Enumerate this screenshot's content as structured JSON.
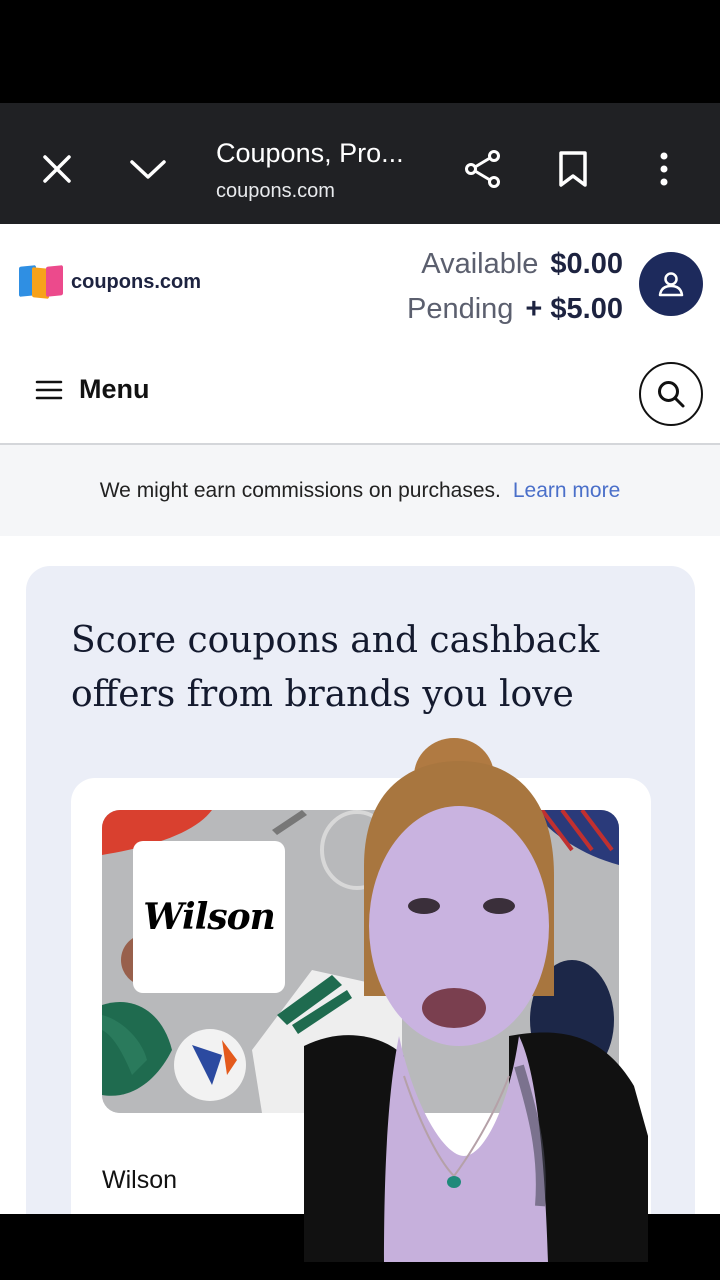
{
  "browser": {
    "tab_title": "Coupons, Pro...",
    "url": "coupons.com"
  },
  "header": {
    "logo_text": "coupons.com",
    "available_label": "Available",
    "available_value": "$0.00",
    "pending_label": "Pending",
    "pending_value": "+ $5.00",
    "menu_label": "Menu"
  },
  "disclaimer": {
    "text": "We might earn commissions on purchases.",
    "link": "Learn more"
  },
  "hero": {
    "title": "Score coupons and cashback offers from brands you love"
  },
  "brand_card": {
    "logo_text": "Wilson",
    "name": "Wilson"
  },
  "colors": {
    "accent_navy": "#1d2a5c",
    "link_blue": "#4a6fc9",
    "hero_bg": "#ebeef7"
  },
  "icons": [
    "close-icon",
    "chevron-down-icon",
    "share-icon",
    "bookmark-icon",
    "more-vert-icon",
    "user-icon",
    "hamburger-icon",
    "search-icon"
  ]
}
